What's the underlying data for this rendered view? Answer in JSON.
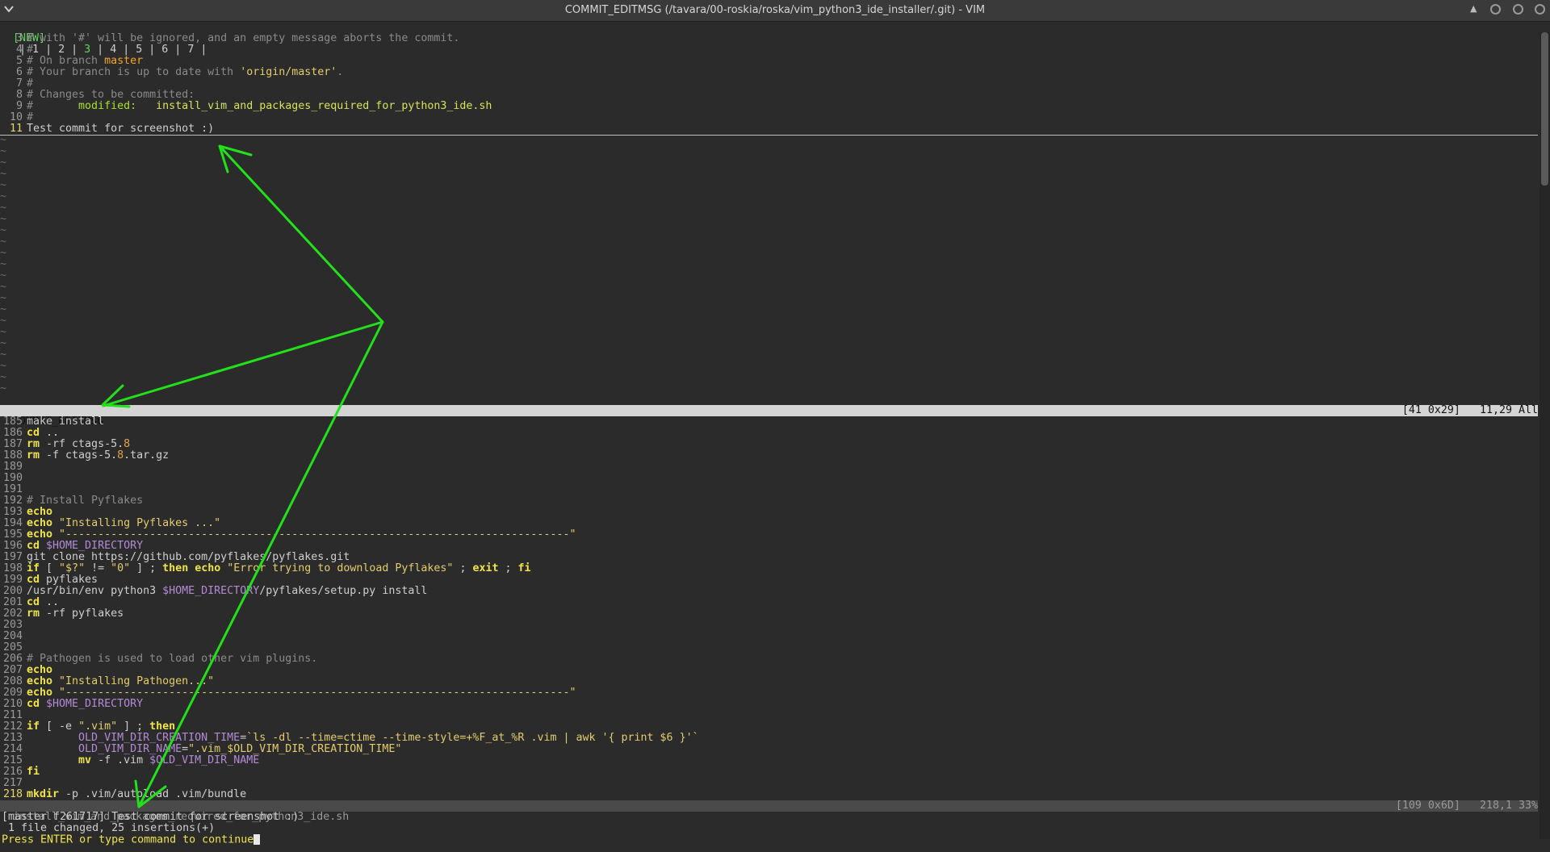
{
  "window": {
    "title": "COMMIT_EDITMSG (/tavara/00-roskia/roska/vim_python3_ide_installer/.git) - VIM",
    "menu_icon": "chevron-down-icon",
    "controls": [
      "up-arrow-icon",
      "minimize-icon",
      "maximize-icon",
      "close-icon"
    ]
  },
  "tabline": {
    "new_label": "[NEW]",
    "tabs": [
      "1",
      "2",
      "3",
      "4",
      "5",
      "6",
      "7"
    ],
    "active_tab": "3"
  },
  "top_pane": {
    "lines": [
      {
        "n": "3",
        "text": "# with '#' will be ignored, and an empty message aborts the commit."
      },
      {
        "n": "4",
        "text": "#"
      },
      {
        "n": "5",
        "pre": "# On branch ",
        "branch": "master"
      },
      {
        "n": "6",
        "pre": "# Your branch is up to date with ",
        "upstream": "'origin/master'",
        "post": "."
      },
      {
        "n": "7",
        "text": "#"
      },
      {
        "n": "8",
        "text": "# Changes to be committed:"
      },
      {
        "n": "9",
        "pre": "#       ",
        "mod": "modified:",
        "file": "   install_vim_and_packages_required_for_python3_ide.sh"
      },
      {
        "n": "10",
        "text": "#"
      },
      {
        "n": "11",
        "text": "Test commit for screenshot :)",
        "current": true
      }
    ],
    "tilde": "~",
    "status": {
      "name": "COMMIT_EDITMSG",
      "size": "[41 0x29]",
      "position": "11,29 All"
    }
  },
  "bottom_pane": {
    "lines": [
      {
        "n": "185",
        "parts": [
          [
            "def",
            "make install"
          ]
        ]
      },
      {
        "n": "186",
        "parts": [
          [
            "kw",
            "cd"
          ],
          [
            "def",
            " .."
          ]
        ]
      },
      {
        "n": "187",
        "parts": [
          [
            "kw",
            "rm"
          ],
          [
            "def",
            " -rf ctags-5."
          ],
          [
            "num",
            "8"
          ]
        ]
      },
      {
        "n": "188",
        "parts": [
          [
            "kw",
            "rm"
          ],
          [
            "def",
            " -f ctags-5."
          ],
          [
            "num",
            "8"
          ],
          [
            "def",
            ".tar.gz"
          ]
        ]
      },
      {
        "n": "189",
        "parts": []
      },
      {
        "n": "190",
        "parts": []
      },
      {
        "n": "191",
        "parts": []
      },
      {
        "n": "192",
        "parts": [
          [
            "com",
            "# Install Pyflakes"
          ]
        ]
      },
      {
        "n": "193",
        "parts": [
          [
            "kw",
            "echo"
          ]
        ]
      },
      {
        "n": "194",
        "parts": [
          [
            "kw",
            "echo"
          ],
          [
            "str",
            " \"Installing Pyflakes ...\""
          ]
        ]
      },
      {
        "n": "195",
        "parts": [
          [
            "kw",
            "echo"
          ],
          [
            "str",
            " \"------------------------------------------------------------------------------\""
          ]
        ]
      },
      {
        "n": "196",
        "parts": [
          [
            "kw",
            "cd"
          ],
          [
            "var",
            " $HOME_DIRECTORY"
          ]
        ]
      },
      {
        "n": "197",
        "parts": [
          [
            "def",
            "git clone https://github.com/pyflakes/pyflakes.git"
          ]
        ]
      },
      {
        "n": "198",
        "parts": [
          [
            "kw",
            "if"
          ],
          [
            "def",
            " [ "
          ],
          [
            "str",
            "\"$?\""
          ],
          [
            "def",
            " != "
          ],
          [
            "str",
            "\"0\""
          ],
          [
            "def",
            " ] ; "
          ],
          [
            "kw",
            "then"
          ],
          [
            "kw",
            " echo"
          ],
          [
            "str",
            " \"Error trying to download Pyflakes\""
          ],
          [
            "def",
            " ; "
          ],
          [
            "kw",
            "exit"
          ],
          [
            "def",
            " ; "
          ],
          [
            "kw",
            "fi"
          ]
        ]
      },
      {
        "n": "199",
        "parts": [
          [
            "kw",
            "cd"
          ],
          [
            "def",
            " pyflakes"
          ]
        ]
      },
      {
        "n": "200",
        "parts": [
          [
            "def",
            "/usr/bin/env python3 "
          ],
          [
            "var",
            "$HOME_DIRECTORY"
          ],
          [
            "def",
            "/pyflakes/setup.py install"
          ]
        ]
      },
      {
        "n": "201",
        "parts": [
          [
            "kw",
            "cd"
          ],
          [
            "def",
            " .."
          ]
        ]
      },
      {
        "n": "202",
        "parts": [
          [
            "kw",
            "rm"
          ],
          [
            "def",
            " -rf pyflakes"
          ]
        ]
      },
      {
        "n": "203",
        "parts": []
      },
      {
        "n": "204",
        "parts": []
      },
      {
        "n": "205",
        "parts": []
      },
      {
        "n": "206",
        "parts": [
          [
            "com",
            "# Pathogen is used to load other vim plugins."
          ]
        ]
      },
      {
        "n": "207",
        "parts": [
          [
            "kw",
            "echo"
          ]
        ]
      },
      {
        "n": "208",
        "parts": [
          [
            "kw",
            "echo"
          ],
          [
            "str",
            " \"Installing Pathogen...\""
          ]
        ]
      },
      {
        "n": "209",
        "parts": [
          [
            "kw",
            "echo"
          ],
          [
            "str",
            " \"------------------------------------------------------------------------------\""
          ]
        ]
      },
      {
        "n": "210",
        "parts": [
          [
            "kw",
            "cd"
          ],
          [
            "var",
            " $HOME_DIRECTORY"
          ]
        ]
      },
      {
        "n": "211",
        "parts": []
      },
      {
        "n": "212",
        "parts": [
          [
            "kw",
            "if"
          ],
          [
            "def",
            " [ -e "
          ],
          [
            "str",
            "\".vim\""
          ],
          [
            "def",
            " ] ; "
          ],
          [
            "kw",
            "then"
          ]
        ]
      },
      {
        "n": "213",
        "parts": [
          [
            "def",
            "        "
          ],
          [
            "var",
            "OLD_VIM_DIR_CREATION_TIME"
          ],
          [
            "def",
            "="
          ],
          [
            "str",
            "`ls -dl --time=ctime --time-style=+%F_at_%R .vim | awk '{ print $6 }'`"
          ]
        ]
      },
      {
        "n": "214",
        "parts": [
          [
            "def",
            "        "
          ],
          [
            "var",
            "OLD_VIM_DIR_NAME"
          ],
          [
            "def",
            "="
          ],
          [
            "str",
            "\".vim_$OLD_VIM_DIR_CREATION_TIME\""
          ]
        ]
      },
      {
        "n": "215",
        "parts": [
          [
            "def",
            "        "
          ],
          [
            "kw",
            "mv"
          ],
          [
            "def",
            " -f .vim "
          ],
          [
            "var",
            "$OLD_VIM_DIR_NAME"
          ]
        ]
      },
      {
        "n": "216",
        "parts": [
          [
            "kw",
            "fi"
          ]
        ]
      },
      {
        "n": "217",
        "parts": []
      },
      {
        "n": "218",
        "parts": [
          [
            "kw",
            "mkdir"
          ],
          [
            "def",
            " -p .vim/autoload .vim/bundle"
          ]
        ],
        "current": true
      }
    ],
    "status": {
      "name": "install_vim_and_packages_required_for_python3_ide.sh",
      "size": "[109 0x6D]",
      "position": "218,1 33%"
    }
  },
  "messages": {
    "commit_result": "[master f261717] Test commit for screenshot :)",
    "stats": " 1 file changed, 25 insertions(+)",
    "prompt": "Press ENTER or type command to continue"
  },
  "annotations": {
    "arrow_color": "#22e01a",
    "arrow_icon": "arrow-annotation-icon"
  }
}
